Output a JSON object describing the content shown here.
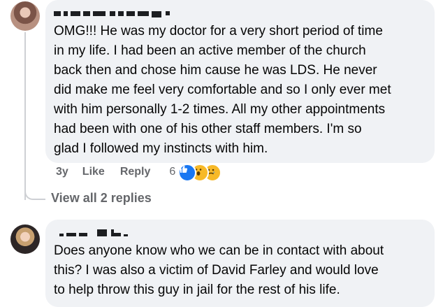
{
  "comments": [
    {
      "text": "OMG!!! He was my doctor for a very short period of time\nin my life. I had been an active member of the church\nback then and chose him cause he was LDS. He never\ndid make me feel very comfortable and so I only ever met\nwith him personally 1-2 times. All my other appointments\nhad been with one of his other staff members. I'm so\nglad I followed my instincts with him.",
      "age": "3y",
      "like_label": "Like",
      "reply_label": "Reply",
      "reaction_count": "6",
      "reactions": [
        "like-icon",
        "wow-icon",
        "sad-icon"
      ]
    },
    {
      "text": "Does anyone know who we can be in contact with about\nthis? I was also a victim of David Farley and would love\nto help throw this guy in jail for the rest of his life."
    }
  ],
  "view_replies": "View all 2 replies",
  "colors": {
    "bubble": "#f0f2f5",
    "meta_text": "#65676b",
    "like_blue": "#1877f2",
    "emoji_yellow": "#f7b928"
  }
}
